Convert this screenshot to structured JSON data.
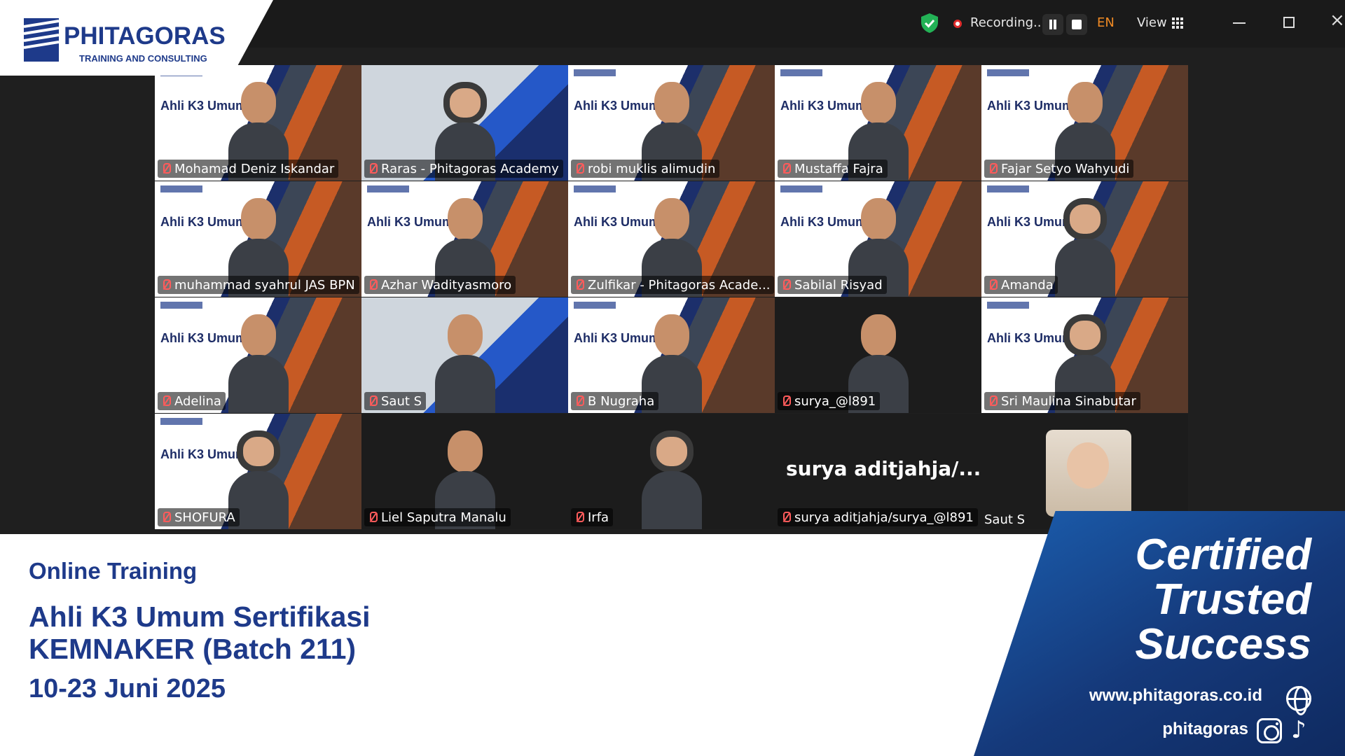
{
  "toolbar": {
    "recording_label": "Recording...",
    "language": "EN",
    "view_label": "View"
  },
  "logo": {
    "name": "PHITAGORAS",
    "tagline": "TRAINING AND CONSULTING"
  },
  "slide_title": "Ahli K3 Umum",
  "participants": [
    "Mohamad Deniz Iskandar",
    "Raras - Phitagoras Academy",
    "robi muklis alimudin",
    "Mustaffa Fajra",
    "Fajar Setyo Wahyudi",
    "muhammad syahrul JAS BPN",
    "Azhar Wadityasmoro",
    "Zulfikar - Phitagoras Acade...",
    "Sabilal Risyad",
    "Amanda",
    "Adelina",
    "Saut S",
    "B Nugraha",
    "surya_@l891",
    "Sri Maulina Sinabutar",
    "SHOFURA",
    "Liel Saputra Manalu",
    "Irfa",
    "surya aditjahja/surya_@l891",
    "Saut S"
  ],
  "big_name": "surya  aditjahja/...",
  "info": {
    "subtitle": "Online Training",
    "title": "Ahli K3 Umum Sertifikasi KEMNAKER (Batch 211)",
    "date": "10-23 Juni 2025"
  },
  "brand": {
    "slogan_1": "Certified",
    "slogan_2": "Trusted",
    "slogan_3": "Success",
    "website": "www.phitagoras.co.id",
    "social": "phitagoras"
  },
  "colors": {
    "brand_blue": "#1e3a8a",
    "active_speaker": "#2ed06e",
    "muted_mic": "#ff5b5b",
    "language_badge": "#f08a24"
  }
}
